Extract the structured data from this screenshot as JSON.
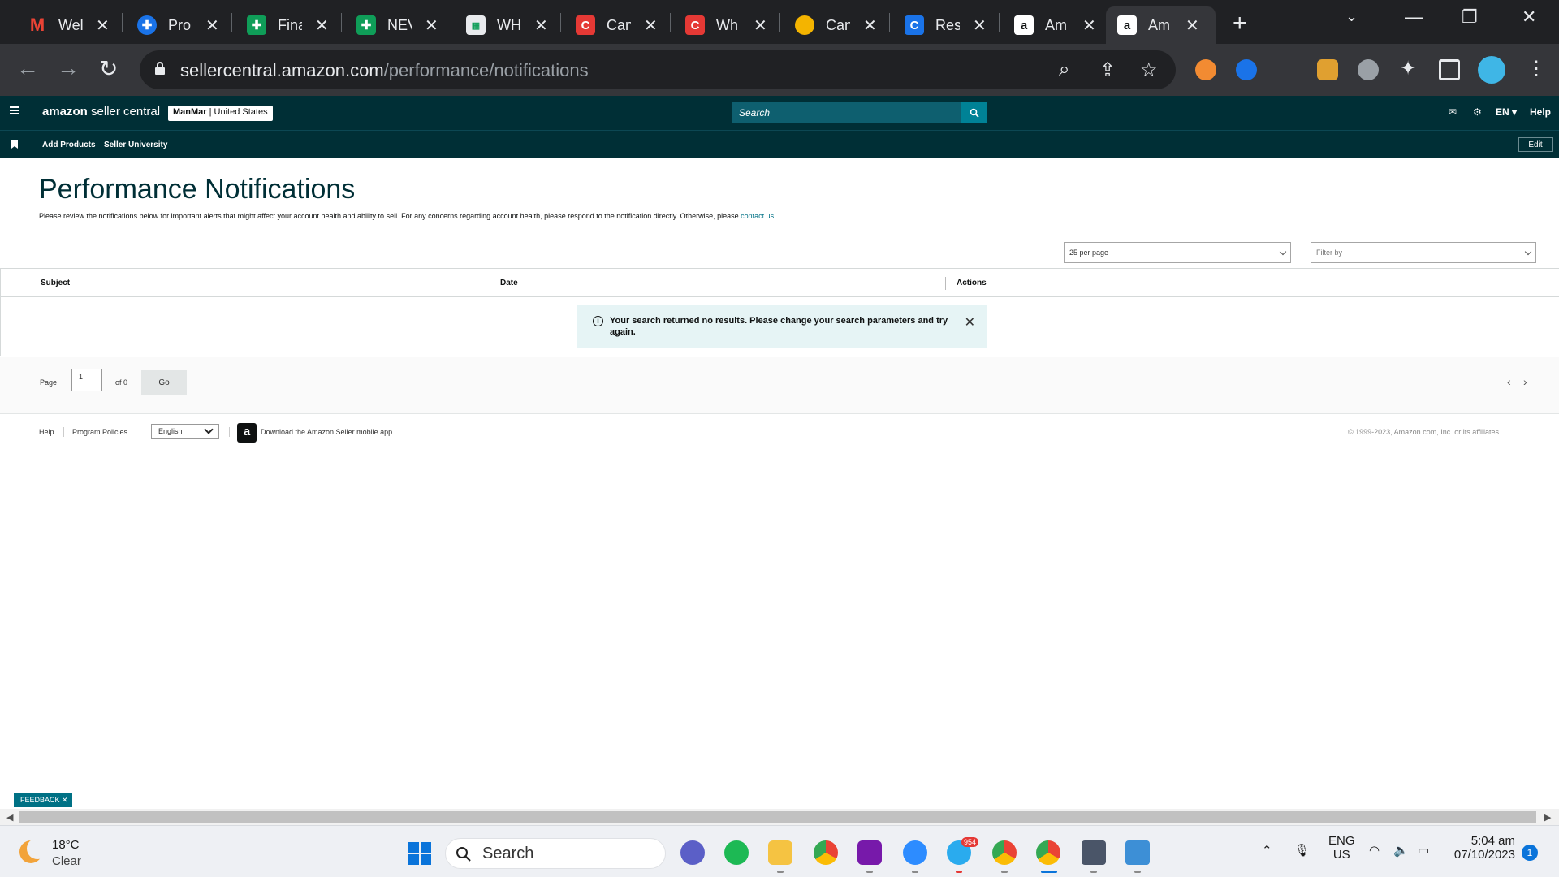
{
  "browser": {
    "tabs": [
      {
        "title": "Wel",
        "icon": "gmail-icon",
        "color": "#ea4335"
      },
      {
        "title": "Pro",
        "icon": "plus-cross-icon",
        "color": "#1a73e8"
      },
      {
        "title": "Fina",
        "icon": "green-plus-icon",
        "color": "#0f9d58"
      },
      {
        "title": "NEV",
        "icon": "green-plus-icon",
        "color": "#0f9d58"
      },
      {
        "title": "WH",
        "icon": "sheet-icon",
        "color": "#e8eaed"
      },
      {
        "title": "Can",
        "icon": "c-red-icon",
        "color": "#e53935"
      },
      {
        "title": "Wh",
        "icon": "c-red-icon",
        "color": "#e53935"
      },
      {
        "title": "Can",
        "icon": "drive-icon",
        "color": "#f4b400"
      },
      {
        "title": "Res",
        "icon": "c-blue-icon",
        "color": "#1a73e8"
      },
      {
        "title": "Am",
        "icon": "amazon-icon",
        "color": "#ffffff"
      },
      {
        "title": "Am",
        "icon": "amazon-icon",
        "color": "#ffffff",
        "active": true
      }
    ],
    "url_host": "sellercentral.amazon.com",
    "url_path": "/performance/notifications"
  },
  "header": {
    "logo_bold": "amazon",
    "logo_rest": " seller central",
    "store_name": "ManMar",
    "store_region": "United States",
    "search_placeholder": "Search",
    "lang": "EN",
    "help": "Help"
  },
  "subnav": {
    "links": [
      "Add Products",
      "Seller University"
    ],
    "edit": "Edit"
  },
  "main": {
    "title": "Performance Notifications",
    "description": "Please review the notifications below for important alerts that might affect your account health and ability to sell. For any concerns regarding account health, please respond to the notification directly. Otherwise, please ",
    "contact_link": "contact us.",
    "per_page": "25 per page",
    "filter": "Filter by",
    "columns": [
      "Subject",
      "Date",
      "Actions"
    ],
    "alert_text": "Your search returned no results. Please change your search parameters and try again."
  },
  "pager": {
    "page_label": "Page",
    "page_value": "1",
    "of_label": "of 0",
    "go": "Go"
  },
  "footer": {
    "help": "Help",
    "policies": "Program Policies",
    "language": "English",
    "app": "Download the Amazon Seller mobile app",
    "copyright": "© 1999-2023, Amazon.com, Inc. or its affiliates"
  },
  "feedback": "FEEDBACK",
  "taskbar": {
    "temp": "18°C",
    "condition": "Clear",
    "search": "Search",
    "telegram_badge": "954",
    "lang1": "ENG",
    "lang2": "US",
    "time": "5:04 am",
    "date": "07/10/2023",
    "notifications": "1"
  }
}
